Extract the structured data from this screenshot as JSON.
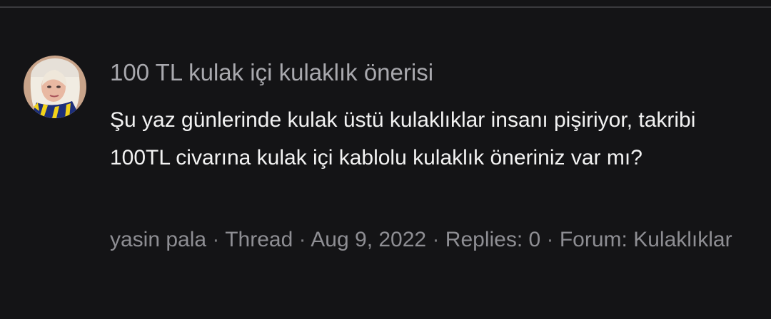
{
  "result": {
    "avatar": {
      "icon": "user-avatar-photo"
    },
    "title": "100 TL kulak içi kulaklık önerisi",
    "snippet": "Şu yaz günlerinde kulak üstü kulaklıklar insanı pişiriyor, takribi 100TL civarına kulak içi kablolu kulaklık öneriniz var mı?",
    "meta": {
      "author": "yasin pala",
      "separator": " · ",
      "type": "Thread",
      "date": "Aug 9, 2022",
      "replies": "Replies: 0",
      "forum_label": "Forum:",
      "forum_name": "Kulaklıklar"
    }
  },
  "colors": {
    "background": "#141416",
    "title": "#a9a9ae",
    "snippet": "#f2f2f2",
    "meta": "#8e8e93"
  }
}
